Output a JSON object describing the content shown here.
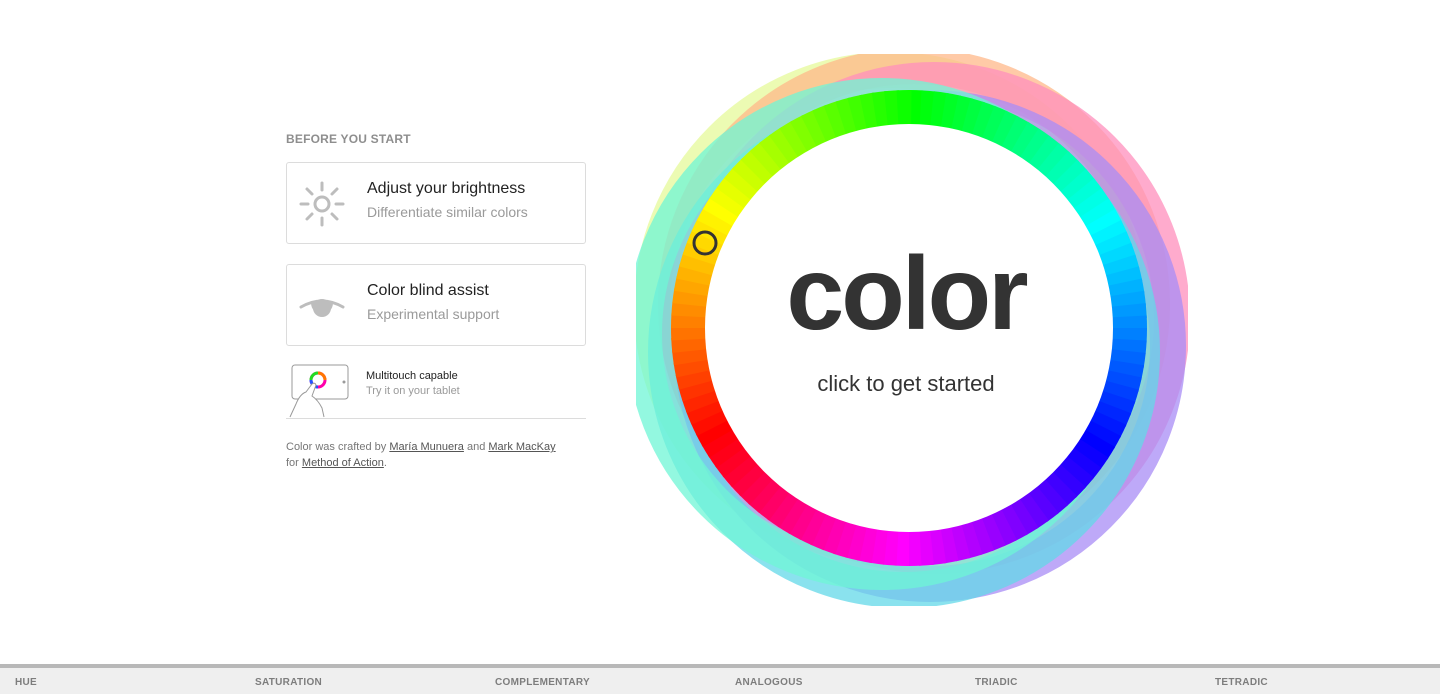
{
  "intro": {
    "section_title": "BEFORE YOU START",
    "cards": [
      {
        "title": "Adjust your brightness",
        "subtitle": "Differentiate similar colors",
        "icon": "sun-icon"
      },
      {
        "title": "Color blind assist",
        "subtitle": "Experimental support",
        "icon": "eye-icon"
      }
    ],
    "multitouch": {
      "title": "Multitouch capable",
      "subtitle": "Try it on your tablet",
      "icon": "tablet-icon"
    }
  },
  "credits": {
    "prefix": "Color was crafted by ",
    "author1": "María Munuera",
    "and": " and ",
    "author2": "Mark MacKay",
    "for": "for ",
    "org": "Method of Action",
    "suffix": "."
  },
  "wheel": {
    "logo": "color",
    "cta": "click to get started",
    "ring_colors": [
      "#ff0000",
      "#ff8000",
      "#ffff00",
      "#00ff00",
      "#00ffff",
      "#0000ff",
      "#8000ff",
      "#ff00ff"
    ],
    "halo_colors": [
      "#e6f99a",
      "#ffb88a",
      "#ff8fbc",
      "#a88cf5",
      "#63d8e8",
      "#6ff5d5"
    ]
  },
  "tabs": [
    "HUE",
    "SATURATION",
    "COMPLEMENTARY",
    "ANALOGOUS",
    "TRIADIC",
    "TETRADIC"
  ]
}
